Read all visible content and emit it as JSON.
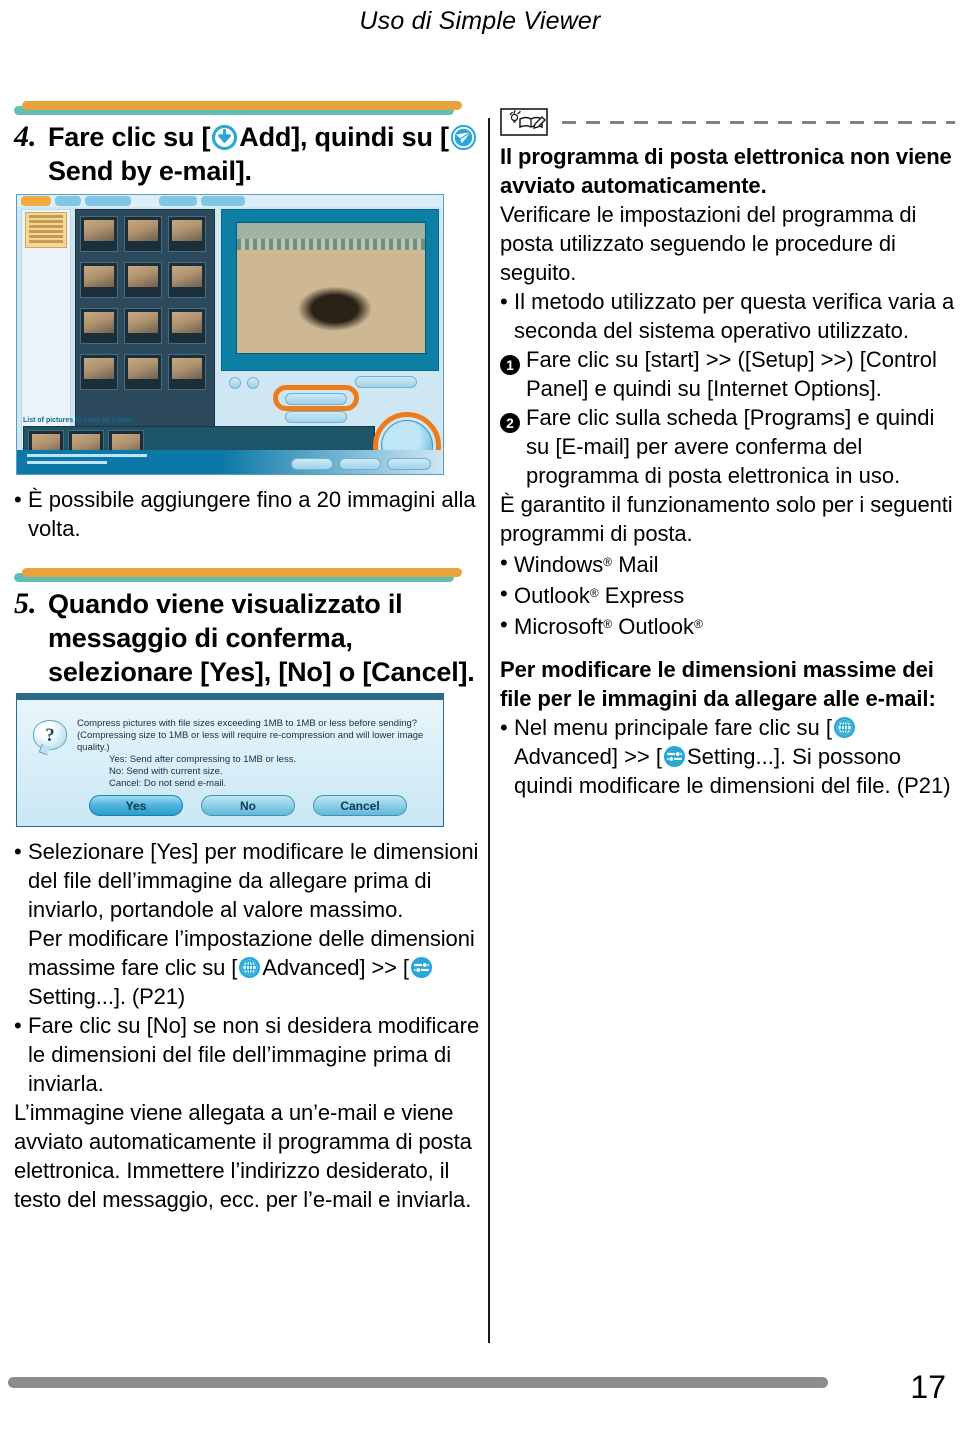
{
  "running_head": "Uso di Simple Viewer",
  "page_number": "17",
  "left_column": {
    "step4": {
      "number": "4.",
      "text_before_icon1": "Fare clic su [",
      "icon1": "download-arrow-icon",
      "text_mid": "Add], quindi su [",
      "icon2": "send-mail-icon",
      "text_after": "Send by e-mail]."
    },
    "viewer_screenshot": {
      "name": "simple-viewer-window",
      "list_label": "List of pictures to send by e-mail",
      "send_button_label": "Send by e-mail"
    },
    "note1": "È possibile aggiungere fino a 20 immagini alla volta.",
    "step5": {
      "number": "5.",
      "text": "Quando viene visualizzato il messaggio di conferma, selezionare [Yes], [No] o [Cancel]."
    },
    "dialog_screenshot": {
      "name": "compress-confirm-dialog",
      "question_line1": "Compress pictures with file sizes exceeding 1MB to 1MB or less before sending?",
      "question_line2": "(Compressing size to 1MB or less will require re-compression and will lower image quality.)",
      "option_yes": "Yes: Send after compressing to 1MB or less.",
      "option_no": "No: Send with current size.",
      "option_cancel": "Cancel: Do not send e-mail.",
      "buttons": [
        "Yes",
        "No",
        "Cancel"
      ]
    },
    "bullets": [
      {
        "lines": [
          "Selezionare [Yes] per modificare le",
          "dimensioni del file dell’immagine da",
          "allegare prima di inviarlo, portandole al",
          "valore massimo."
        ]
      }
    ],
    "para_advanced": {
      "line1": "Per modificare l’impostazione delle",
      "line2": "dimensioni massime fare clic su",
      "prefix": "[",
      "icon1": "globe-advanced-icon",
      "mid": "Advanced] >> [",
      "icon2": "setting-slider-icon",
      "suffix": "Setting...]. (P21)"
    },
    "bullet_no": {
      "lines": [
        "Fare clic su [No] se non si desidera",
        "modificare le dimensioni del file",
        "dell’immagine prima di inviarla."
      ]
    },
    "closing_para": "L’immagine viene allegata a un’e-mail e viene avviato automaticamente il programma di posta elettronica. Immettere l’indirizzo desiderato, il testo del messaggio, ecc. per l’e-mail e inviarla."
  },
  "right_column": {
    "note_icon": "note-book-bulb-icon",
    "heading_bold": "Il programma di posta elettronica non viene avviato automaticamente.",
    "para1": "Verificare le impostazioni del programma di posta utilizzato seguendo le procedure di seguito.",
    "bullet1": "Il metodo utilizzato per questa verifica varia a seconda del sistema operativo utilizzato.",
    "numbered": [
      {
        "num": "1",
        "text": "Fare clic su [start] >> ([Setup] >>) [Control Panel] e quindi su [Internet Options]."
      },
      {
        "num": "2",
        "text": "Fare clic sulla scheda [Programs] e quindi su [E-mail] per avere conferma del programma di posta elettronica in uso."
      }
    ],
    "para2": "È garantito il funzionamento solo per i seguenti programmi di posta.",
    "mail_programs": [
      {
        "name": "Windows",
        "reg1": "®",
        "tail": " Mail"
      },
      {
        "name": "Outlook",
        "reg1": "®",
        "tail": " Express"
      },
      {
        "name": "Microsoft",
        "reg1": "®",
        "tail": " Outlook",
        "reg2": "®"
      }
    ],
    "heading_bold2": "Per modificare le dimensioni massime dei file per le immagini da allegare alle e-mail:",
    "last_bullet": {
      "line1": "Nel menu principale fare clic su",
      "prefix": "[",
      "icon1": "globe-advanced-icon",
      "mid": "Advanced] >> [",
      "icon2": "setting-slider-icon",
      "suffix": "Setting...]. Si",
      "line3": "possono quindi modificare le dimensioni",
      "line4": "del file. (P21)"
    }
  },
  "colors": {
    "bar_orange": "#e8a33d",
    "bar_teal": "#62bdb2",
    "icon_blue": "#29a8d8",
    "highlight_orange": "#ef7c1b",
    "footer_gray": "#8d8d8d"
  }
}
